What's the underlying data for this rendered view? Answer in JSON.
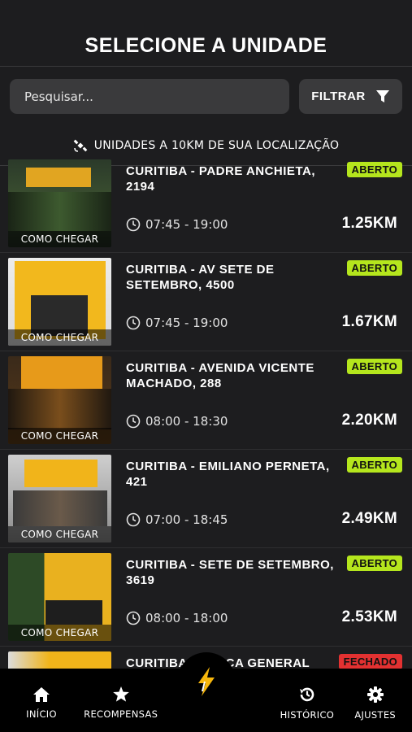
{
  "header": {
    "title": "SELECIONE A UNIDADE"
  },
  "search": {
    "placeholder": "Pesquisar..."
  },
  "filter": {
    "label": "FILTRAR"
  },
  "location": {
    "text": "UNIDADES A 10KM DE SUA LOCALIZAÇÃO"
  },
  "units": [
    {
      "name": "CURITIBA - PADRE ANCHIETA, 2194",
      "status": "ABERTO",
      "hours": "07:45 - 19:00",
      "distance": "1.25KM",
      "cta": "COMO CHEGAR"
    },
    {
      "name": "CURITIBA - AV SETE DE SETEMBRO, 4500",
      "status": "ABERTO",
      "hours": "07:45 - 19:00",
      "distance": "1.67KM",
      "cta": "COMO CHEGAR"
    },
    {
      "name": "CURITIBA - AVENIDA VICENTE MACHADO, 288",
      "status": "ABERTO",
      "hours": "08:00 - 18:30",
      "distance": "2.20KM",
      "cta": "COMO CHEGAR"
    },
    {
      "name": "CURITIBA - EMILIANO PERNETA, 421",
      "status": "ABERTO",
      "hours": "07:00 - 18:45",
      "distance": "2.49KM",
      "cta": "COMO CHEGAR"
    },
    {
      "name": "CURITIBA - SETE DE SETEMBRO, 3619",
      "status": "ABERTO",
      "hours": "08:00 - 18:00",
      "distance": "2.53KM",
      "cta": "COMO CHEGAR"
    },
    {
      "name": "CURITIBA -        CA GENERAL",
      "status": "FECHADO"
    }
  ],
  "nav": {
    "inicio": "INÍCIO",
    "recompensas": "RECOMPENSAS",
    "historico": "HISTÓRICO",
    "ajustes": "AJUSTES"
  },
  "colors": {
    "open": "#b5e61d",
    "closed": "#e33131",
    "background": "#1d1d1f",
    "accent": "#f6b60c"
  }
}
